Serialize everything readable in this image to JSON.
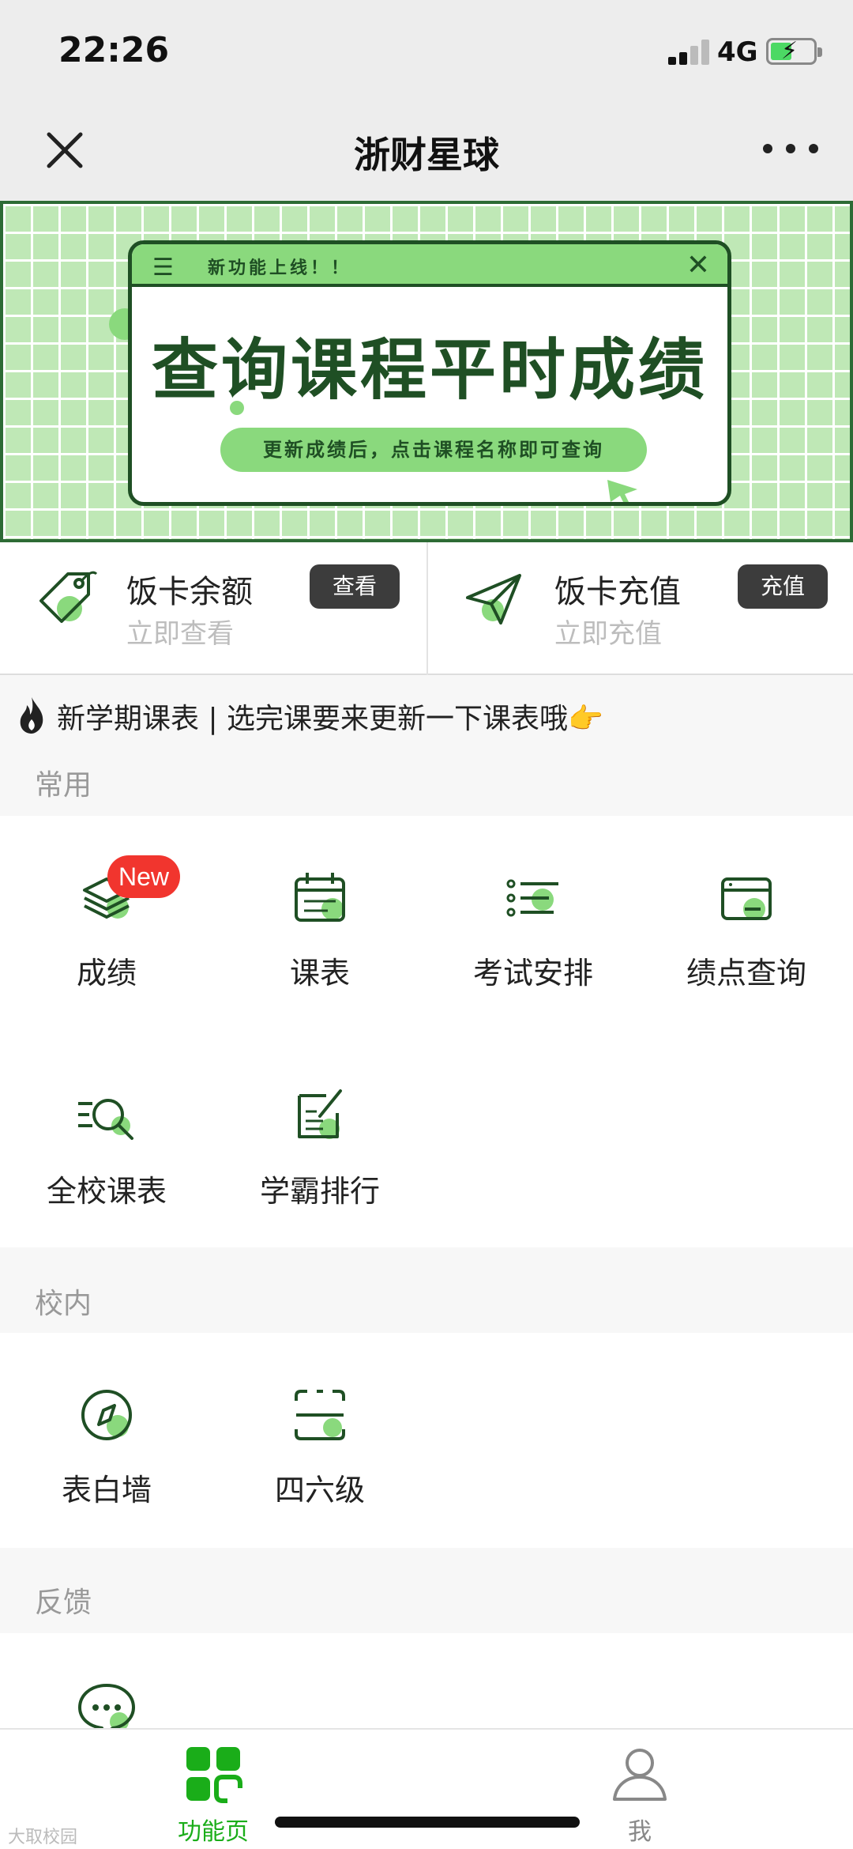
{
  "status_bar": {
    "time": "22:26",
    "network": "4G"
  },
  "navbar": {
    "title": "浙财星球"
  },
  "banner": {
    "tag": "新功能上线！！",
    "headline": "查询课程平时成绩",
    "subtitle": "更新成绩后，点击课程名称即可查询"
  },
  "cards": [
    {
      "title": "饭卡余额",
      "subtitle": "立即查看",
      "button": "查看",
      "icon": "tag-icon"
    },
    {
      "title": "饭卡充值",
      "subtitle": "立即充值",
      "button": "充值",
      "icon": "paper-plane-icon"
    }
  ],
  "notice": {
    "text": "新学期课表 | 选完课要来更新一下课表哦👉"
  },
  "sections": {
    "common": {
      "label": "常用",
      "items": [
        {
          "label": "成绩",
          "icon": "stack-icon",
          "badge": "New"
        },
        {
          "label": "课表",
          "icon": "calendar-icon"
        },
        {
          "label": "考试安排",
          "icon": "list-icon"
        },
        {
          "label": "绩点查询",
          "icon": "card-icon"
        },
        {
          "label": "全校课表",
          "icon": "search-list-icon"
        },
        {
          "label": "学霸排行",
          "icon": "edit-note-icon"
        }
      ]
    },
    "campus": {
      "label": "校内",
      "items": [
        {
          "label": "表白墙",
          "icon": "compass-icon"
        },
        {
          "label": "四六级",
          "icon": "scan-icon"
        }
      ]
    },
    "feedback": {
      "label": "反馈",
      "items": [
        {
          "label": "",
          "icon": "chat-icon"
        }
      ]
    }
  },
  "tabbar": {
    "tabs": [
      {
        "label": "功能页",
        "active": true
      },
      {
        "label": "我",
        "active": false
      }
    ]
  },
  "watermark": "大取校园",
  "colors": {
    "accent": "#1aad19",
    "dark_green": "#1f4f24",
    "light_green": "#8ad97d",
    "badge_red": "#f1352e"
  }
}
